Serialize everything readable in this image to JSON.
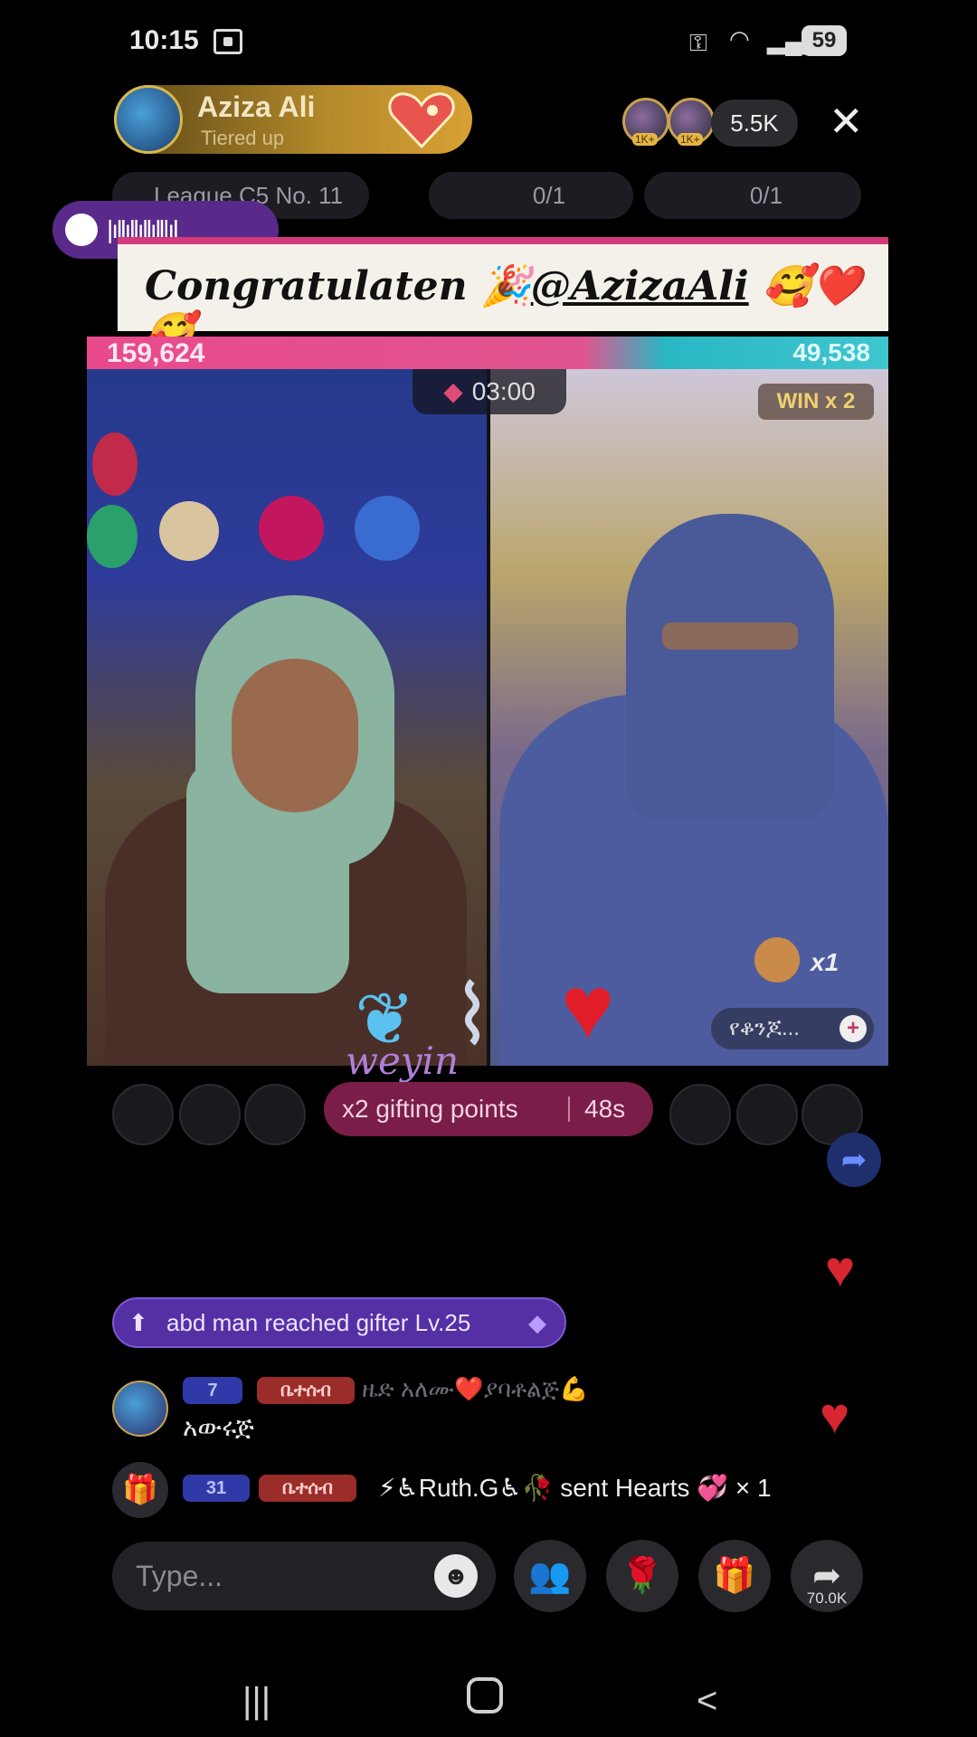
{
  "status": {
    "time": "10:15",
    "battery": "59"
  },
  "host": {
    "name": "Aziza Ali",
    "subtitle": "Tiered up"
  },
  "viewers": {
    "badge1": "1K+",
    "badge2": "1K+",
    "count": "5.5K"
  },
  "league": {
    "label": "League C5 No. 11",
    "stat1": "0/1",
    "stat2": "0/1"
  },
  "banner": {
    "text": "Congratulaten 🎉",
    "handle": "@AzizaAli",
    "emojis": "🥰❤️🥰"
  },
  "battle": {
    "left_score": "159,624",
    "right_score": "49,538",
    "timer": "03:00",
    "win_label": "WIN x 2",
    "multiplier": "x1",
    "guest_label": "የቆንጆ..."
  },
  "gift_overlay": {
    "caption": "weyin"
  },
  "gifting": {
    "label": "x2 gifting points",
    "time": "48s"
  },
  "level_up": {
    "text": "abd man reached gifter Lv.25"
  },
  "chat": [
    {
      "badge_level": "7",
      "badge_tag": "ቤተሰብ",
      "name": "ዜድ አለሙ❤️ያባቶልጅ💪",
      "message": "አውሩጅ"
    },
    {
      "badge_level": "31",
      "badge_tag": "ቤተሰብ",
      "sender": "⚡♿Ruth.G♿🥀",
      "text": "sent Hearts 💞 × 1"
    }
  ],
  "composer": {
    "placeholder": "Type...",
    "share_count": "70.0K"
  },
  "icons": [
    "screen-record-icon",
    "key-icon",
    "wifi-icon",
    "signal-icon",
    "close-icon",
    "spotify-icon",
    "gift-icon",
    "emoji-icon",
    "multi-guest-icon",
    "rose-icon",
    "share-icon",
    "recent-apps-icon",
    "home-icon",
    "back-icon"
  ]
}
